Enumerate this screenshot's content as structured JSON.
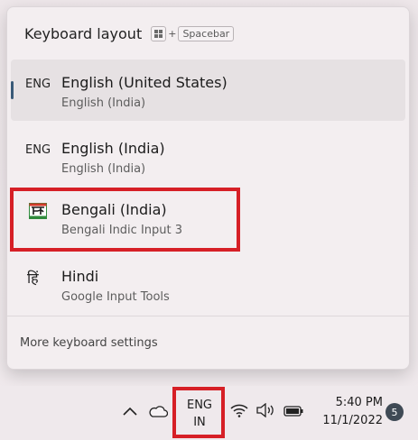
{
  "flyout": {
    "title": "Keyboard layout",
    "shortcut": {
      "plus": "+",
      "key": "Spacebar"
    },
    "items": [
      {
        "code": "ENG",
        "name": "English (United States)",
        "sub": "English (India)",
        "selected": true
      },
      {
        "code": "ENG",
        "name": "English (India)",
        "sub": "English (India)",
        "selected": false
      },
      {
        "icon": "bengali-indic-input-icon",
        "name": "Bengali (India)",
        "sub": "Bengali Indic Input 3",
        "selected": false
      },
      {
        "glyph": "हिं",
        "name": "Hindi",
        "sub": "Google Input Tools",
        "selected": false
      }
    ],
    "footer_link": "More keyboard settings"
  },
  "taskbar": {
    "icons": [
      "chevron-up-icon",
      "onedrive-cloud-icon",
      "wifi-icon",
      "volume-icon",
      "battery-icon"
    ],
    "language": {
      "line1": "ENG",
      "line2": "IN"
    },
    "clock": {
      "time": "5:40 PM",
      "date": "11/1/2022"
    },
    "notification_count": "5"
  },
  "colors": {
    "highlight": "#d61f26",
    "selected_indicator": "#3a5a78",
    "badge": "#3f4a55"
  }
}
